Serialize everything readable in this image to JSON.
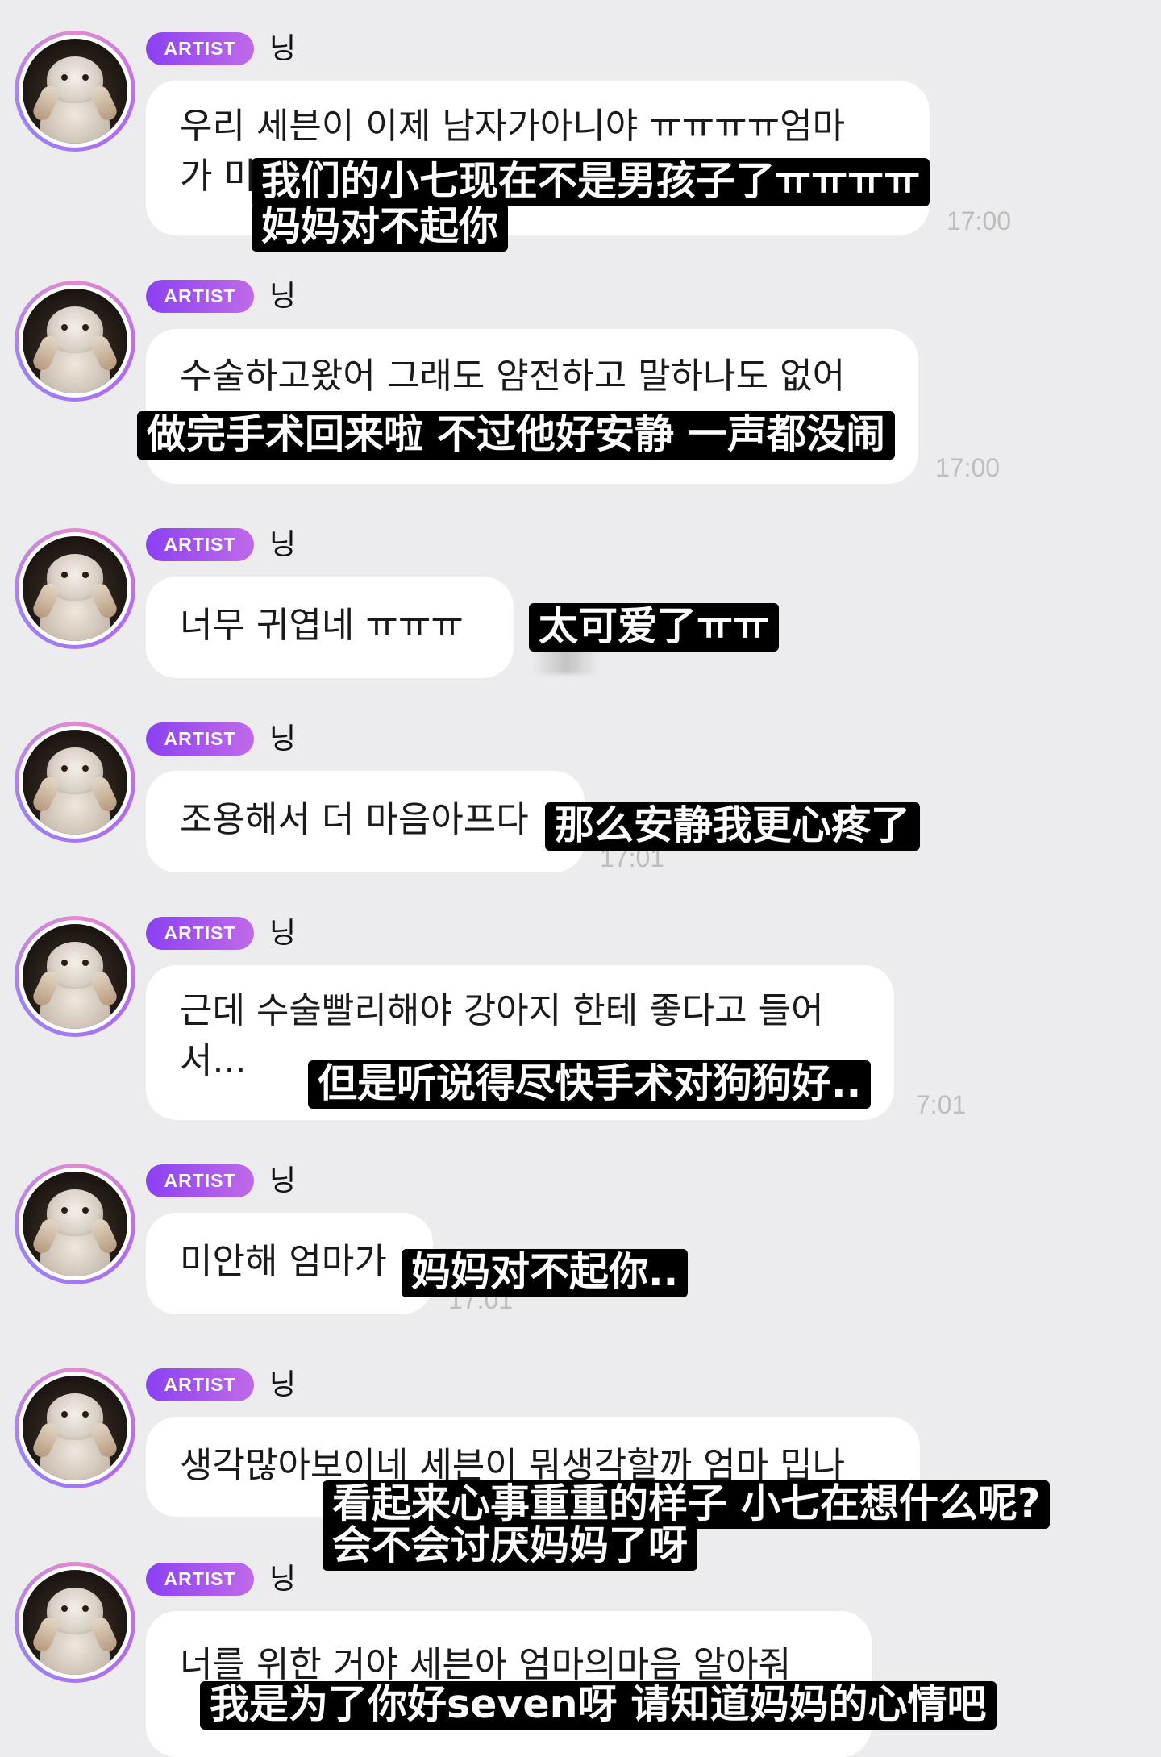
{
  "badge_label": "ARTIST",
  "sender_name": "닝",
  "avatar_icon": "cat-avatar-icon",
  "messages": [
    {
      "text": "우리 세븐이 이제 남자가아니야 ㅠㅠㅠㅠ엄마\n가 미",
      "time": "17:00",
      "subtitle": [
        "我们的小七现在不是男孩子了ㅠㅠㅠㅠ",
        "妈妈对不起你"
      ]
    },
    {
      "text": "수술하고왔어 그래도 얌전하고 말하나도 없어",
      "time": "17:00",
      "subtitle": [
        "做完手术回来啦 不过他好安静 一声都没闹"
      ]
    },
    {
      "text": "너무 귀엽네 ㅠㅠㅠ",
      "time": "",
      "subtitle": [
        "太可爱了ㅠㅠ"
      ]
    },
    {
      "text": "조용해서 더 마음아프다",
      "time": "17:01",
      "subtitle": [
        "那么安静我更心疼了"
      ]
    },
    {
      "text": "근데 수술빨리해야 강아지 한테 좋다고 들어\n서...",
      "time": "7:01",
      "subtitle": [
        "但是听说得尽快手术对狗狗好.."
      ]
    },
    {
      "text": "미안해 엄마가",
      "time": "17:01",
      "subtitle": [
        "妈妈对不起你.."
      ]
    },
    {
      "text": "생각많아보이네 세븐이 뭐생각할까 엄마 밉나",
      "time": "",
      "subtitle": [
        "看起来心事重重的样子 小七在想什么呢?",
        "会不会讨厌妈妈了呀"
      ]
    },
    {
      "text": "너를 위한 거야 세븐아 엄마의마음 알아줘",
      "time": "",
      "subtitle": [
        "我是为了你好seven呀 请知道妈妈的心情吧"
      ]
    }
  ]
}
